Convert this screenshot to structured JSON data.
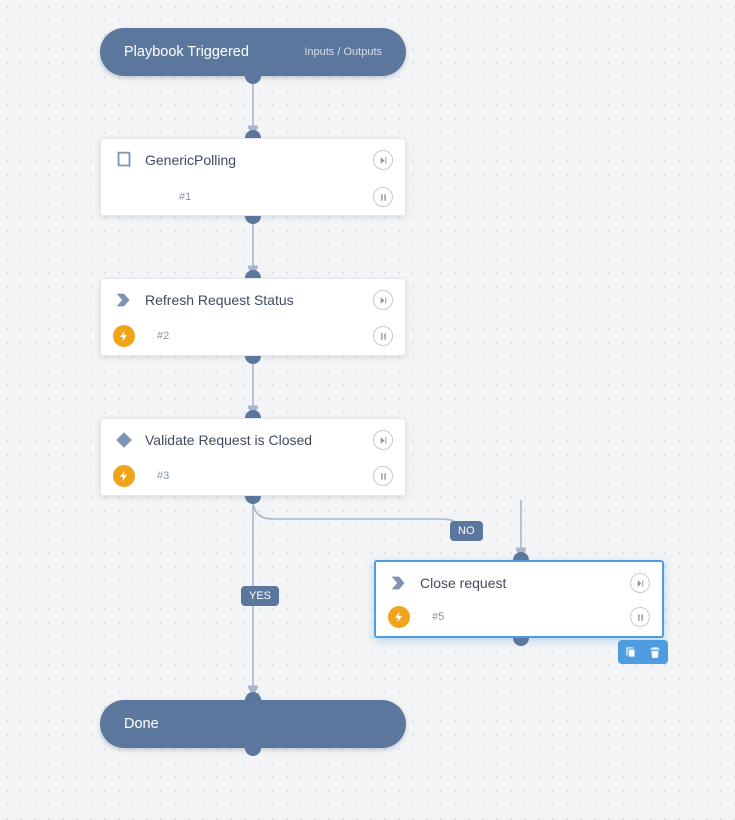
{
  "header": {
    "title": "Playbook Triggered",
    "subtitle": "Inputs / Outputs"
  },
  "footer": {
    "title": "Done"
  },
  "branches": {
    "yes": "YES",
    "no": "NO"
  },
  "tasks": [
    {
      "id": "t1",
      "title": "GenericPolling",
      "index": "#1",
      "shape": "book",
      "bolt": false,
      "selected": false
    },
    {
      "id": "t2",
      "title": "Refresh Request Status",
      "index": "#2",
      "shape": "chevron",
      "bolt": true,
      "selected": false
    },
    {
      "id": "t3",
      "title": "Validate Request is Closed",
      "index": "#3",
      "shape": "diamond",
      "bolt": true,
      "selected": false
    },
    {
      "id": "t5",
      "title": "Close request",
      "index": "#5",
      "shape": "chevron",
      "bolt": true,
      "selected": true
    }
  ],
  "colors": {
    "primary": "#5c779e",
    "accent": "#4d9de0",
    "bolt": "#f0a41a"
  },
  "icons": {
    "book": "book-icon",
    "chevron": "chevron-icon",
    "diamond": "diamond-icon",
    "bolt": "bolt-icon",
    "skip": "skip-icon",
    "pause": "pause-icon",
    "copy": "copy-icon",
    "trash": "trash-icon"
  }
}
